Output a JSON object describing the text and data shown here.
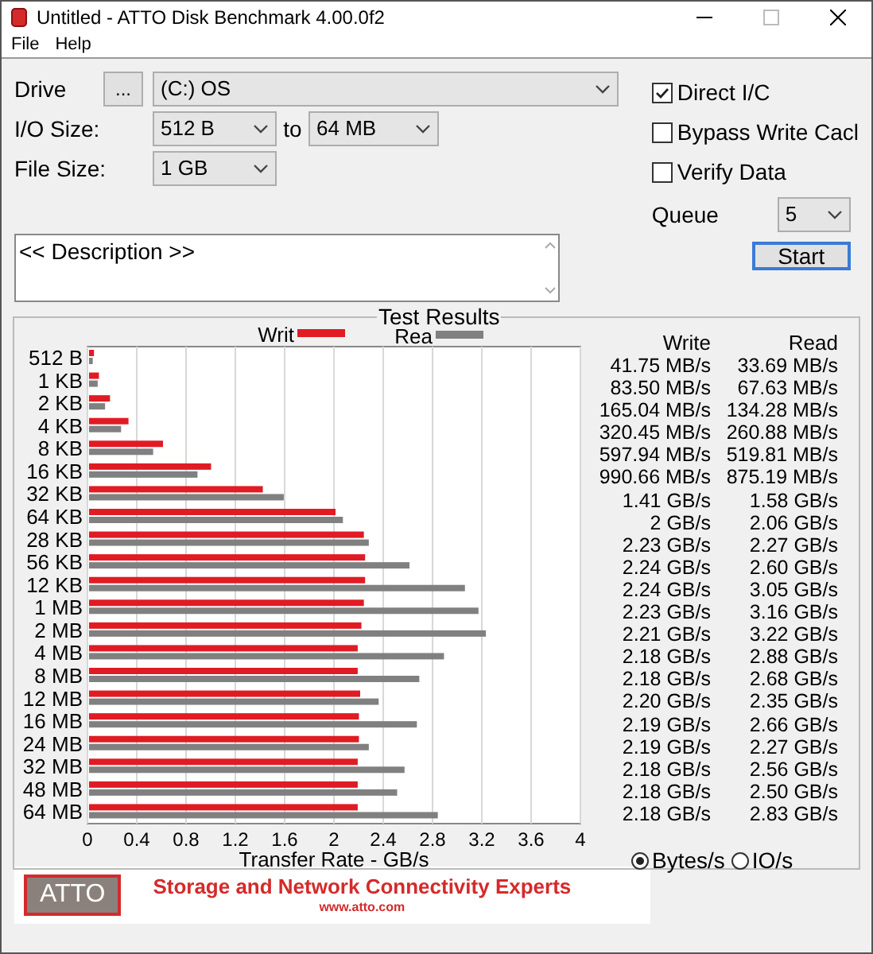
{
  "window": {
    "title": "Untitled - ATTO Disk Benchmark 4.00.0f2"
  },
  "menu": [
    "File",
    "Help"
  ],
  "settings": {
    "drive_label": "Drive",
    "browse_button": "...",
    "drive": "(C:) OS",
    "io_size_label": "I/O Size:",
    "io_from": "512 B",
    "to_label": "to",
    "io_to": "64 MB",
    "file_size_label": "File Size:",
    "file_size": "1 GB"
  },
  "options": [
    {
      "label": "Direct I/C",
      "checked": true
    },
    {
      "label": "Bypass Write Cacl",
      "checked": false
    },
    {
      "label": "Verify Data",
      "checked": false
    }
  ],
  "queue": {
    "label": "Queue",
    "value": "5"
  },
  "start_button": "Start",
  "description": "<< Description >>",
  "results": {
    "title": "Test Results",
    "columns": [
      "Write",
      "Read"
    ],
    "rows": [
      {
        "write": "41.75 MB/s",
        "read": "33.69 MB/s"
      },
      {
        "write": "83.50 MB/s",
        "read": "67.63 MB/s"
      },
      {
        "write": "165.04 MB/s",
        "read": "134.28 MB/s"
      },
      {
        "write": "320.45 MB/s",
        "read": "260.88 MB/s"
      },
      {
        "write": "597.94 MB/s",
        "read": "519.81 MB/s"
      },
      {
        "write": "990.66 MB/s",
        "read": "875.19 MB/s"
      },
      {
        "write": "1.41 GB/s",
        "read": "1.58 GB/s"
      },
      {
        "write": "2 GB/s",
        "read": "2.06 GB/s"
      },
      {
        "write": "2.23 GB/s",
        "read": "2.27 GB/s"
      },
      {
        "write": "2.24 GB/s",
        "read": "2.60 GB/s"
      },
      {
        "write": "2.24 GB/s",
        "read": "3.05 GB/s"
      },
      {
        "write": "2.23 GB/s",
        "read": "3.16 GB/s"
      },
      {
        "write": "2.21 GB/s",
        "read": "3.22 GB/s"
      },
      {
        "write": "2.18 GB/s",
        "read": "2.88 GB/s"
      },
      {
        "write": "2.18 GB/s",
        "read": "2.68 GB/s"
      },
      {
        "write": "2.20 GB/s",
        "read": "2.35 GB/s"
      },
      {
        "write": "2.19 GB/s",
        "read": "2.66 GB/s"
      },
      {
        "write": "2.19 GB/s",
        "read": "2.27 GB/s"
      },
      {
        "write": "2.18 GB/s",
        "read": "2.56 GB/s"
      },
      {
        "write": "2.18 GB/s",
        "read": "2.50 GB/s"
      },
      {
        "write": "2.18 GB/s",
        "read": "2.83 GB/s"
      }
    ],
    "chart_data": {
      "type": "bar",
      "orientation": "horizontal",
      "xlabel": "Transfer Rate - GB/s",
      "categories": [
        "512 B",
        "1 KB",
        "2 KB",
        "4 KB",
        "8 KB",
        "16 KB",
        "32 KB",
        "64 KB",
        "28 KB",
        "56 KB",
        "12 KB",
        "1 MB",
        "2 MB",
        "4 MB",
        "8 MB",
        "12 MB",
        "16 MB",
        "24 MB",
        "32 MB",
        "48 MB",
        "64 MB"
      ],
      "series": [
        {
          "name": "Writ",
          "color": "#e01b24",
          "values": [
            0.04,
            0.08,
            0.17,
            0.32,
            0.6,
            0.99,
            1.41,
            2,
            2.23,
            2.24,
            2.24,
            2.23,
            2.21,
            2.18,
            2.18,
            2.2,
            2.19,
            2.19,
            2.18,
            2.18,
            2.18
          ]
        },
        {
          "name": "Rea",
          "color": "#808080",
          "values": [
            0.03,
            0.07,
            0.13,
            0.26,
            0.52,
            0.88,
            1.58,
            2.06,
            2.27,
            2.6,
            3.05,
            3.16,
            3.22,
            2.88,
            2.68,
            2.35,
            2.66,
            2.27,
            2.56,
            2.5,
            2.83
          ]
        }
      ],
      "xlim": [
        0,
        4
      ],
      "grid": true,
      "legend": "top",
      "xticks": [
        0,
        0.4,
        0.8,
        1.2,
        1.6,
        2,
        2.4,
        2.8,
        3.2,
        3.6,
        4
      ]
    }
  },
  "units": [
    {
      "label": "Bytes/s",
      "selected": true
    },
    {
      "label": "IO/s",
      "selected": false
    }
  ],
  "banner": {
    "logo": "ATTO",
    "tagline": "Storage and Network Connectivity Experts",
    "url": "www.atto.com"
  }
}
